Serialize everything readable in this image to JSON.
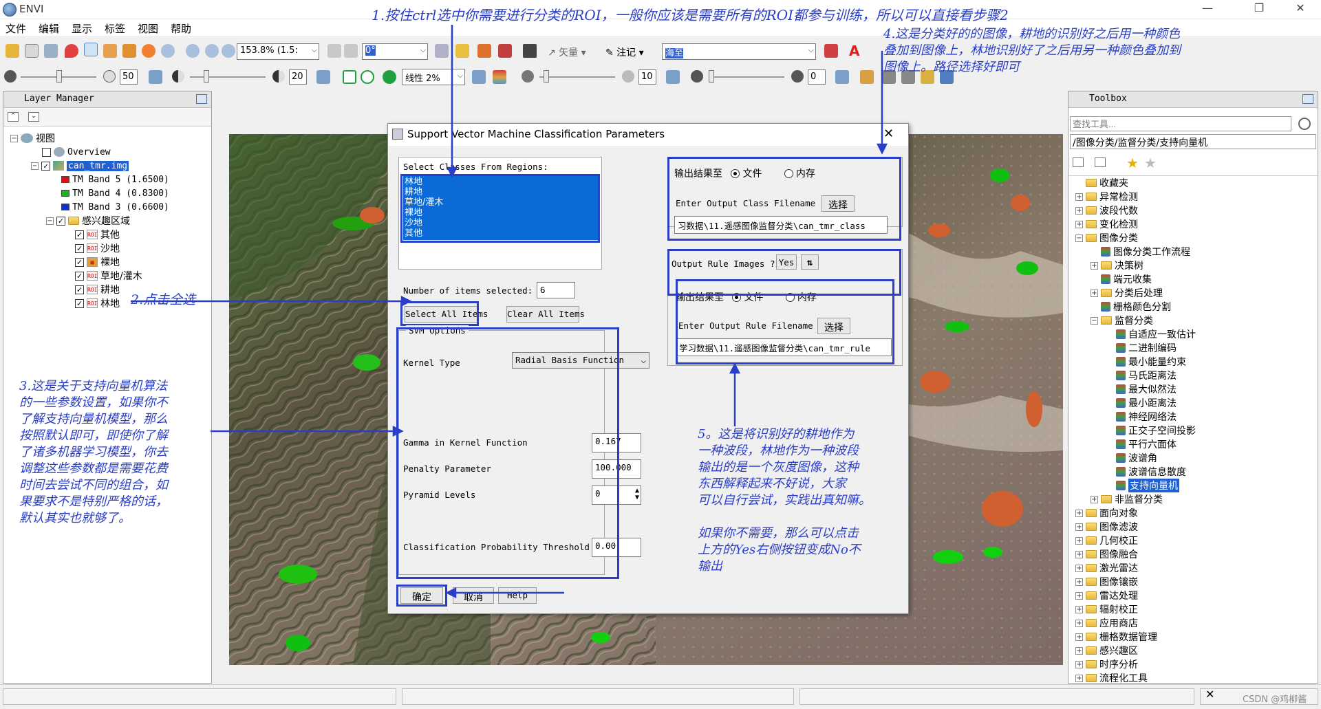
{
  "app": {
    "title": "ENVI"
  },
  "menu": [
    "文件",
    "编辑",
    "显示",
    "标签",
    "视图",
    "帮助"
  ],
  "toolbar1": {
    "zoom": "153.8% (1.5:",
    "rotate": "0°",
    "vector_label": "矢量",
    "annotation_label": "注记",
    "search_value": "海至"
  },
  "toolbar2": {
    "brightness": "50",
    "contrast": "20",
    "stretch": "线性 2%",
    "sharpen": "10",
    "transparency": "0"
  },
  "layer_manager": {
    "title": "Layer Manager",
    "root": "视图",
    "overview": "Overview",
    "file": "can_tmr.img",
    "bands": [
      "TM Band 5 (1.6500)",
      "TM Band 4 (0.8300)",
      "TM Band 3 (0.6600)"
    ],
    "band_colors": [
      "#e01010",
      "#20b020",
      "#1030d0"
    ],
    "roi_group": "感兴趣区域",
    "rois": [
      "其他",
      "沙地",
      "裸地",
      "草地/灌木",
      "耕地",
      "林地"
    ]
  },
  "toolbox": {
    "title": "Toolbox",
    "search_placeholder": "查找工具...",
    "path": "/图像分类/监督分类/支持向量机",
    "top_folders": [
      "收藏夹",
      "异常检测",
      "波段代数",
      "变化检测",
      "图像分类"
    ],
    "classification_children": [
      "图像分类工作流程",
      "决策树",
      "端元收集",
      "分类后处理",
      "栅格颜色分割",
      "监督分类"
    ],
    "supervised": [
      "自适应一致估计",
      "二进制编码",
      "最小能量约束",
      "马氏距离法",
      "最大似然法",
      "最小距离法",
      "神经网络法",
      "正交子空间投影",
      "平行六面体",
      "波谱角",
      "波谱信息散度",
      "支持向量机"
    ],
    "after_supervised": "非监督分类",
    "bottom_folders": [
      "面向对象",
      "图像滤波",
      "几何校正",
      "图像融合",
      "激光雷达",
      "图像镶嵌",
      "雷达处理",
      "辐射校正",
      "应用商店",
      "栅格数据管理",
      "感兴趣区",
      "时序分析",
      "流程化工具"
    ]
  },
  "dialog": {
    "title": "Support Vector Machine Classification Parameters",
    "select_classes_label": "Select Classes From Regions:",
    "classes": [
      "林地",
      "耕地",
      "草地/灌木",
      "裸地",
      "沙地",
      "其他"
    ],
    "items_selected_label": "Number of items selected:",
    "items_selected": "6",
    "select_all": "Select All Items",
    "clear_all": "Clear All Items",
    "svm_options": "SVM Options",
    "kernel_label": "Kernel Type",
    "kernel_value": "Radial Basis Function",
    "gamma_label": "Gamma in Kernel Function",
    "gamma_value": "0.167",
    "penalty_label": "Penalty Parameter",
    "penalty_value": "100.000",
    "pyramid_label": "Pyramid Levels",
    "pyramid_value": "0",
    "threshold_label": "Classification Probability Threshold",
    "threshold_value": "0.00",
    "output_to": "输出结果至",
    "file_opt": "文件",
    "mem_opt": "内存",
    "class_filename_label": "Enter Output Class Filename",
    "choose": "选择",
    "class_filename": "习数据\\11.遥感图像监督分类\\can_tmr_class",
    "rule_images_label": "Output Rule Images ?",
    "rule_images_value": "Yes",
    "rule_filename_label": "Enter Output Rule Filename",
    "rule_filename": "学习数据\\11.遥感图像监督分类\\can_tmr_rule",
    "ok": "确定",
    "cancel": "取消",
    "help": "Help"
  },
  "annotations": {
    "note1": "1.按住ctrl选中你需要进行分类的ROI，一般你应该是需要所有的ROI都参与训练，所以可以直接看步骤2",
    "note2": "2.点击全选",
    "note3": "3.这是关于支持向量机算法\n的一些参数设置，如果你不\n了解支持向量机模型，那么\n按照默认即可，即使你了解\n了诸多机器学习模型，你去\n调整这些参数都是需要花费\n时间去尝试不同的组合，如\n果要求不是特别严格的话，\n默认其实也就够了。",
    "note4": "4.这是分类好的的图像，耕地的识别好之后用一种颜色\n叠加到图像上，林地识别好了之后用另一种颜色叠加到\n图像上。路径选择好即可",
    "note5": "5。这是将识别好的耕地作为\n一种波段，林地作为一种波段\n输出的是一个灰度图像，这种\n东西解释起来不好说，大家\n可以自行尝试，实践出真知嘛。\n\n如果你不需要，那么可以点击\n上方的Yes右侧按钮变成No不\n输出",
    "watermark": "CSDN @鸡柳酱"
  }
}
